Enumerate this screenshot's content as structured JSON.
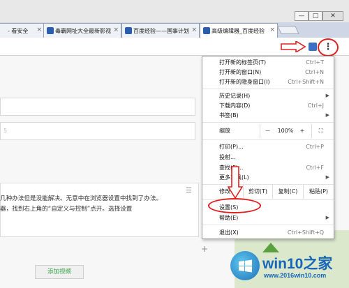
{
  "tabs": [
    {
      "label": "- 看安全"
    },
    {
      "label": "毒霸网址大全最新影视"
    },
    {
      "label": "百度经验——国事计划"
    },
    {
      "label": "高级编辑器_百度经验"
    }
  ],
  "window_controls": {
    "minimize": "—",
    "maximize": "□",
    "close": "✕"
  },
  "menu": {
    "new_tab": {
      "label": "打开新的标签页(T)",
      "shortcut": "Ctrl+T"
    },
    "new_window": {
      "label": "打开新的窗口(N)",
      "shortcut": "Ctrl+N"
    },
    "incognito": {
      "label": "打开新的隐身窗口(I)",
      "shortcut": "Ctrl+Shift+N"
    },
    "history": {
      "label": "历史记录(H)"
    },
    "downloads": {
      "label": "下载内容(D)",
      "shortcut": "Ctrl+J"
    },
    "bookmarks": {
      "label": "书签(B)"
    },
    "zoom": {
      "label": "缩放",
      "minus": "－",
      "value": "100%",
      "plus": "+",
      "fullscreen": "⛶"
    },
    "print": {
      "label": "打印(P)...",
      "shortcut": "Ctrl+P"
    },
    "cast": {
      "label": "投射..."
    },
    "find": {
      "label": "查找(F)...",
      "shortcut": "Ctrl+F"
    },
    "more_tools": {
      "label": "更多工具(L)"
    },
    "edit": {
      "label": "修改",
      "cut": "剪切(T)",
      "copy": "复制(C)",
      "paste": "粘贴(P)"
    },
    "settings": {
      "label": "设置(S)"
    },
    "help": {
      "label": "帮助(E)"
    },
    "exit": {
      "label": "退出(X)",
      "shortcut": "Ctrl+Shift+Q"
    }
  },
  "content": {
    "paragraph_line1": "几种办法但是没能解决。无意中在浏览器设置中找到了办法。",
    "paragraph_line2": "器，找到右上角的“自定义与控制”点开。选择设置",
    "paragraph_line3": "",
    "add_video": "添加视频",
    "field_hint": "5"
  },
  "watermark": {
    "brand": "win10之家",
    "url": "www.2016win10.com"
  },
  "colors": {
    "highlight": "#e0201e",
    "accent": "#1566b8"
  }
}
